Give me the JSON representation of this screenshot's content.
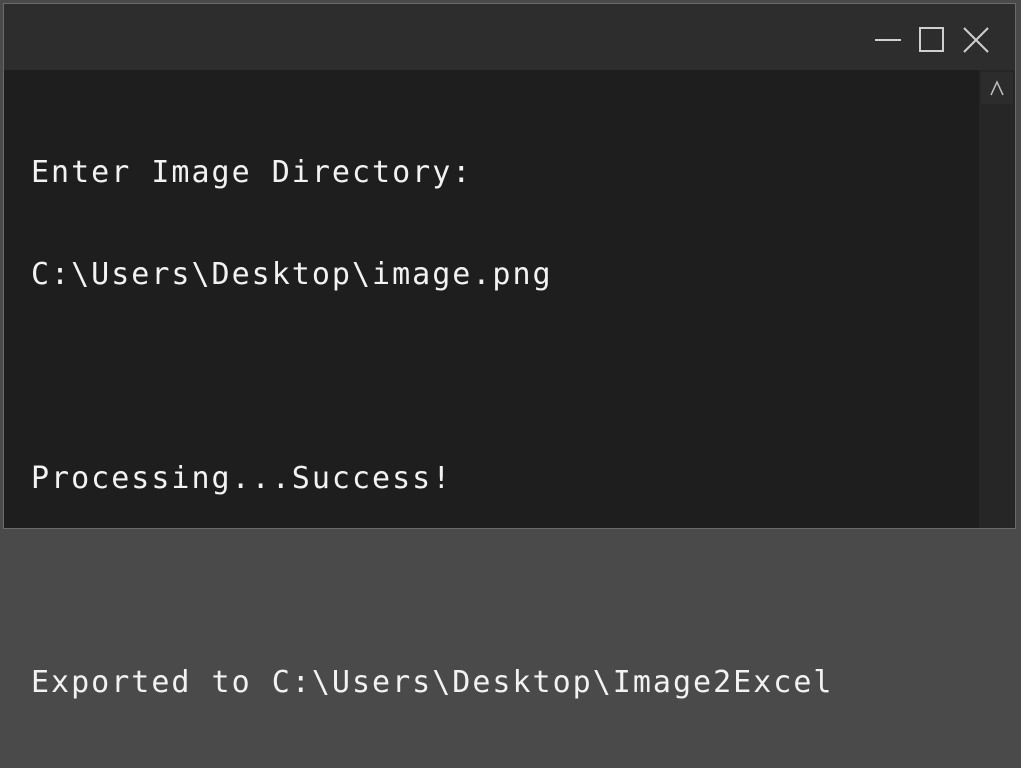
{
  "window": {
    "controls": {
      "minimize": "minimize-icon",
      "maximize": "maximize-icon",
      "close": "close-icon"
    }
  },
  "console": {
    "lines": [
      "Enter Image Directory:",
      "C:\\Users\\Desktop\\image.png",
      "",
      "Processing...Success!",
      "",
      "Exported to C:\\Users\\Desktop\\Image2Excel"
    ]
  },
  "scrollbar": {
    "up_icon": "chevron-up-icon"
  }
}
